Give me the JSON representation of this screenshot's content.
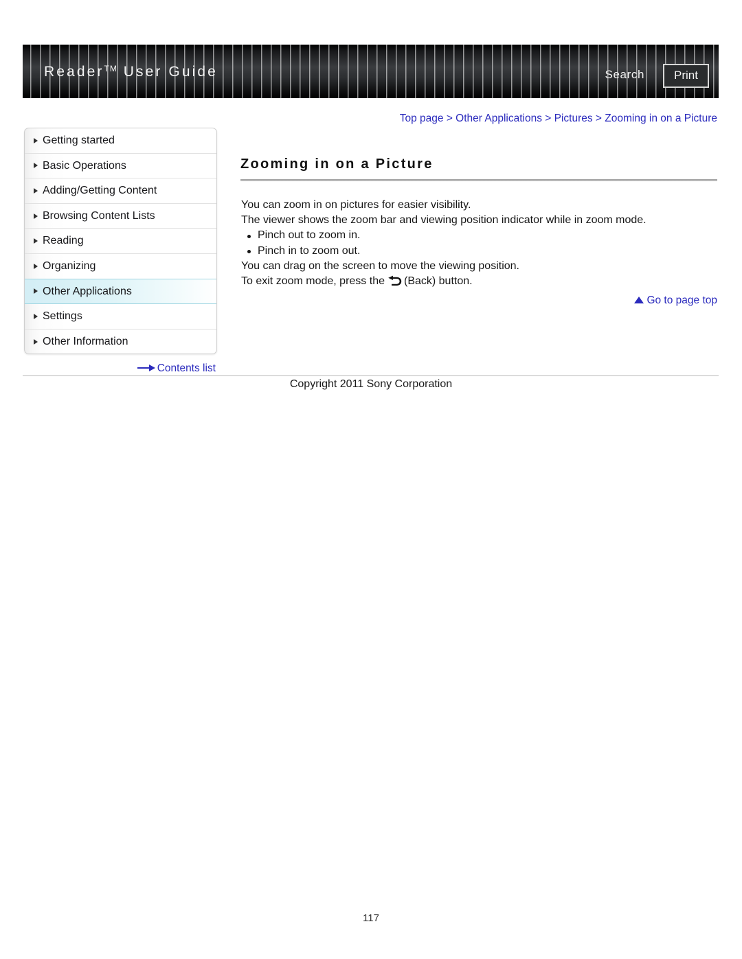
{
  "header": {
    "title": "Reader",
    "title_tm": "TM",
    "title_rest": "User Guide",
    "search_label": "Search",
    "print_label": "Print"
  },
  "breadcrumb": {
    "text": "Top page > Other Applications > Pictures > Zooming in on a Picture"
  },
  "sidebar": {
    "items": [
      {
        "label": "Getting started",
        "active": false
      },
      {
        "label": "Basic Operations",
        "active": false
      },
      {
        "label": "Adding/Getting Content",
        "active": false
      },
      {
        "label": "Browsing Content Lists",
        "active": false
      },
      {
        "label": "Reading",
        "active": false
      },
      {
        "label": "Organizing",
        "active": false
      },
      {
        "label": "Other Applications",
        "active": true
      },
      {
        "label": "Settings",
        "active": false
      },
      {
        "label": "Other Information",
        "active": false
      }
    ],
    "contents_list_label": "Contents list"
  },
  "main": {
    "title": "Zooming in on a Picture",
    "paragraph_1": "You can zoom in on pictures for easier visibility.",
    "paragraph_2": "The viewer shows the zoom bar and viewing position indicator while in zoom mode.",
    "bullets": [
      "Pinch out to zoom in.",
      "Pinch in to zoom out."
    ],
    "paragraph_3": "You can drag on the screen to move the viewing position.",
    "paragraph_4_before": "To exit zoom mode, press the",
    "paragraph_4_after": "(Back) button.",
    "go_to_top_label": "Go to page top"
  },
  "footer": {
    "copyright": "Copyright 2011 Sony Corporation",
    "page_number": "117"
  },
  "colors": {
    "link_blue": "#2b2bbd",
    "highlight_cyan": "#d3eef5",
    "banner_dark": "#1a1b1d",
    "rule_gray": "#b3b3b3"
  }
}
